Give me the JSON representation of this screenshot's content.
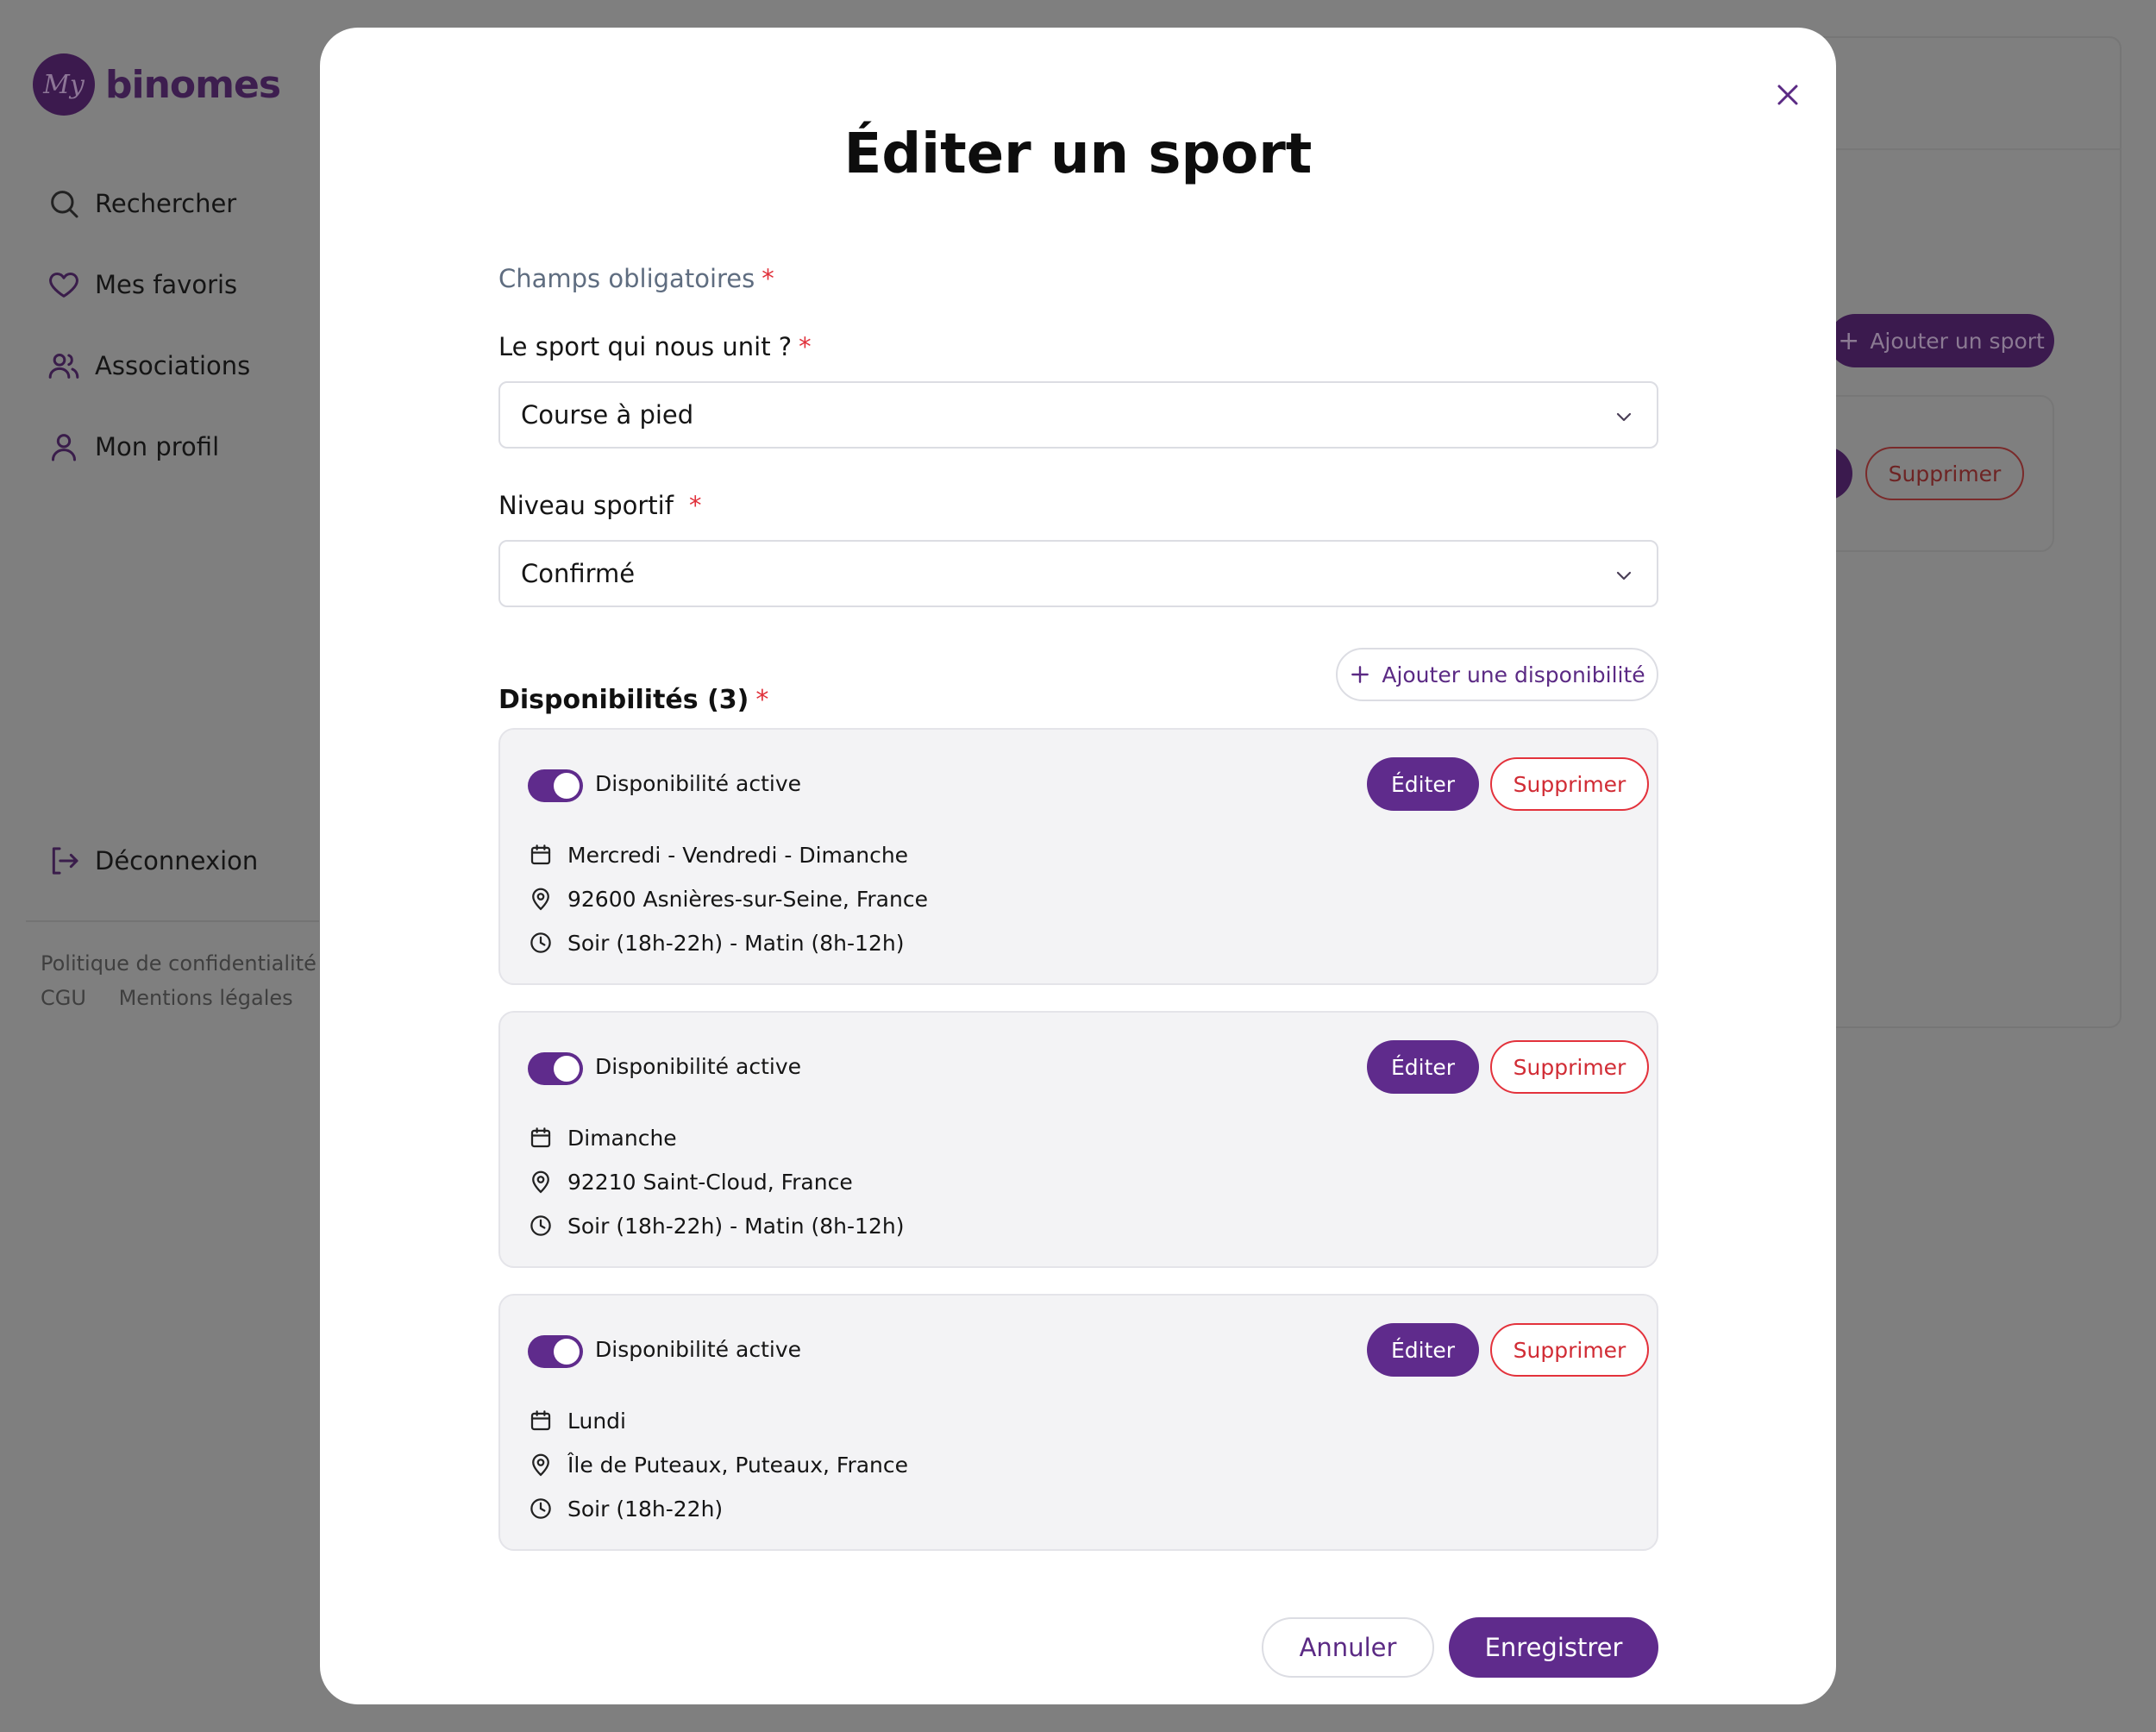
{
  "app": {
    "logo_badge": "My",
    "logo_text": "binomes",
    "nav": [
      {
        "label": "Rechercher",
        "icon": "search-icon"
      },
      {
        "label": "Mes favoris",
        "icon": "heart-icon"
      },
      {
        "label": "Associations",
        "icon": "users-icon"
      },
      {
        "label": "Mon profil",
        "icon": "user-icon"
      }
    ],
    "logout_label": "Déconnexion",
    "footer": {
      "privacy": "Politique de confidentialité",
      "cgu": "CGU",
      "legal": "Mentions légales"
    },
    "add_sport_label": "Ajouter un sport",
    "delete_label": "Supprimer"
  },
  "modal": {
    "title": "Éditer un sport",
    "required_note": "Champs obligatoires",
    "required_mark": "*",
    "sport_label": "Le sport qui nous unit ?",
    "sport_value": "Course à pied",
    "level_label": "Niveau sportif",
    "level_value": "Confirmé",
    "dispo_title": "Disponibilités (3)",
    "add_dispo_label": "Ajouter une disponibilité",
    "availabilities": [
      {
        "status": "Disponibilité active",
        "active": true,
        "days": "Mercredi - Vendredi - Dimanche",
        "location": "92600 Asnières-sur-Seine, France",
        "times": "Soir (18h-22h) - Matin (8h-12h)"
      },
      {
        "status": "Disponibilité active",
        "active": true,
        "days": "Dimanche",
        "location": "92210 Saint-Cloud, France",
        "times": "Soir (18h-22h) - Matin (8h-12h)"
      },
      {
        "status": "Disponibilité active",
        "active": true,
        "days": "Lundi",
        "location": "Île de Puteaux, Puteaux, France",
        "times": "Soir (18h-22h)"
      }
    ],
    "edit_label": "Éditer",
    "delete_label": "Supprimer",
    "cancel_label": "Annuler",
    "save_label": "Enregistrer"
  },
  "colors": {
    "accent": "#5f2b8c",
    "danger": "#e3323c",
    "overlay": "#7f7f7f"
  }
}
